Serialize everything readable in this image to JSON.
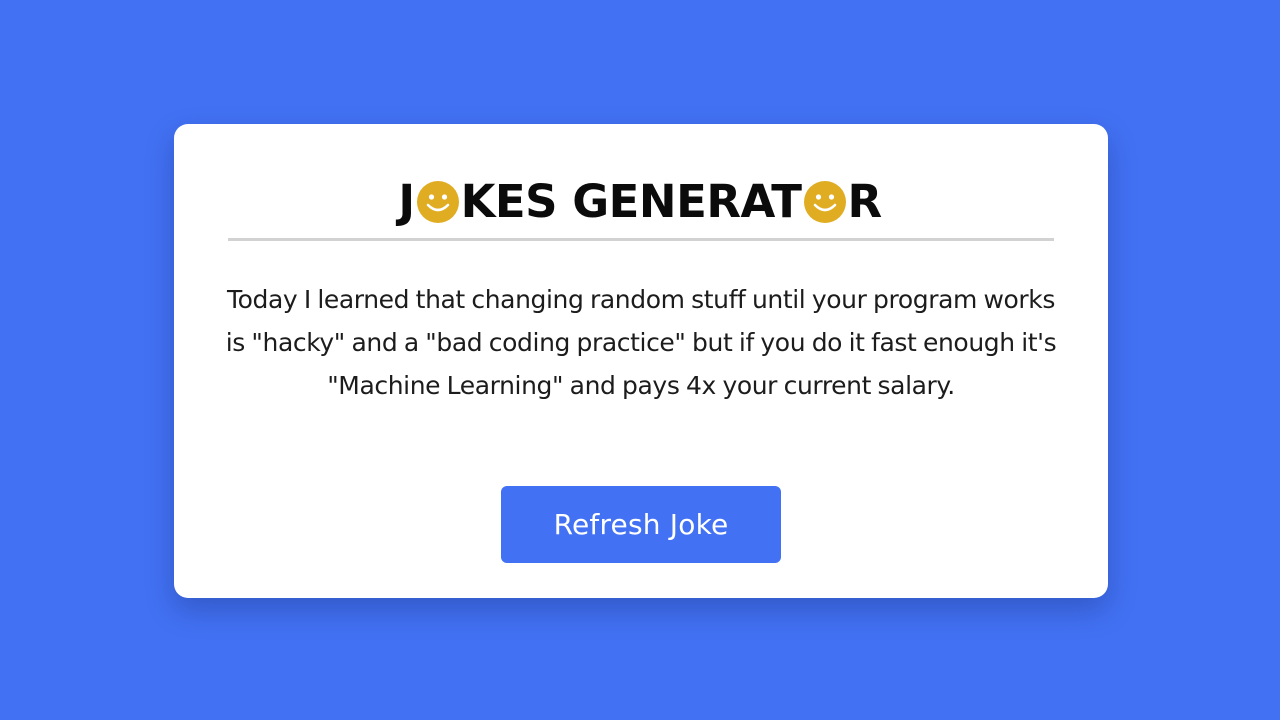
{
  "colors": {
    "background": "#4271f3",
    "card": "#ffffff",
    "accent_button": "#4271f3",
    "smiley": "#e0ad22",
    "title_text": "#0b0b0b",
    "body_text": "#1c1c1c",
    "divider": "#d2d2d2"
  },
  "header": {
    "title_part1": "J",
    "title_part2": "KES GENERAT",
    "title_part3": "R",
    "title_icons": [
      "smiley-face-icon",
      "smiley-face-icon"
    ]
  },
  "joke": {
    "text": "Today I learned that changing random stuff until your program works is \"hacky\" and a \"bad coding practice\" but if you do it fast enough it's \"Machine Learning\" and pays 4x your current salary."
  },
  "actions": {
    "refresh_label": "Refresh Joke"
  }
}
